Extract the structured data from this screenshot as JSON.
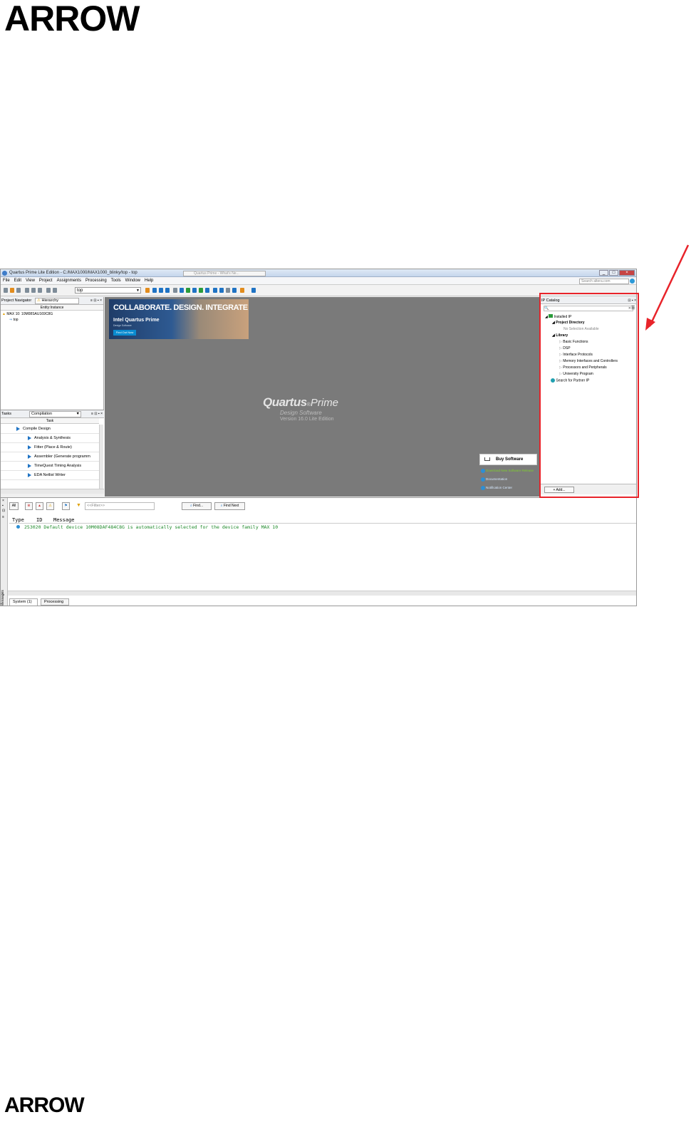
{
  "logo": {
    "top": "ARROW",
    "bottom": "ARROW"
  },
  "window": {
    "title": "Quartus Prime Lite Edition - C:/MAX1000/MAX1000_blinky/top - top",
    "tab": "Quartus Prime - What's Ne...",
    "search_placeholder": "Search altera.com"
  },
  "menu": [
    "File",
    "Edit",
    "View",
    "Project",
    "Assignments",
    "Processing",
    "Tools",
    "Window",
    "Help"
  ],
  "toolbar": {
    "revision": "top"
  },
  "project_navigator": {
    "label": "Project Navigator",
    "view": "Hierarchy",
    "column": "Entity:Instance",
    "device": "MAX 10: 10M08SAU169C8G",
    "entity": "top"
  },
  "tasks": {
    "label": "Tasks",
    "flow": "Compilation",
    "column": "Task",
    "items": [
      "Compile Design",
      "Analysis & Synthesis",
      "Fitter (Place & Route)",
      "Assembler (Generate programm",
      "TimeQuest Timing Analysis",
      "EDA Netlist Writer"
    ]
  },
  "center": {
    "banner_headline": "COLLABORATE. DESIGN. INTEGRATE",
    "banner_product": "Intel Quartus Prime",
    "banner_sub": "Design Software",
    "banner_button": "Find Out Now",
    "logo_word1": "Quartus",
    "logo_word2": "Prime",
    "logo_sub": "Design Software",
    "version": "Version 16.0 Lite Edition",
    "buy": "Buy Software",
    "links": [
      "Download New Software Release",
      "Documentation",
      "Notification Center"
    ]
  },
  "ip_catalog": {
    "title": "IP Catalog",
    "installed": "Installed IP",
    "project_dir": "Project Directory",
    "no_selection": "No Selection Available",
    "library": "Library",
    "items": [
      "Basic Functions",
      "DSP",
      "Interface Protocols",
      "Memory Interfaces and Controllers",
      "Processors and Peripherals",
      "University Program"
    ],
    "partner": "Search for Partner IP",
    "add": "+ Add..."
  },
  "messages": {
    "all": "All",
    "filter_placeholder": "<<Filter>>",
    "find": "Find...",
    "find_next": "Find Next",
    "cols": {
      "type": "Type",
      "id": "ID",
      "message": "Message"
    },
    "row": {
      "id": "253020",
      "text": "Default device 10M08DAF484C8G is automatically selected for the device family MAX 10"
    },
    "side_label": "Messages",
    "tabs": [
      "System (1)",
      "Processing"
    ]
  },
  "colors": {
    "annotation": "#e8232a",
    "canvas": "#7a7a7a"
  }
}
